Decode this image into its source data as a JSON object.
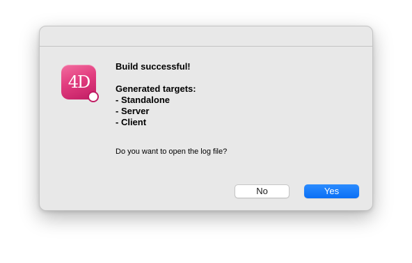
{
  "dialog": {
    "app_icon": {
      "name": "4d-app-icon",
      "glyph": "4D",
      "accent": "#e23d7f"
    },
    "message_lines": [
      "Build successful!",
      "",
      "Generated targets:",
      "- Standalone",
      "- Server",
      "- Client"
    ],
    "question": "Do you want to open the log file?",
    "buttons": {
      "no_label": "No",
      "yes_label": "Yes"
    },
    "colors": {
      "primary_button": "#0a6ff5",
      "background": "#e8e8e8"
    }
  }
}
